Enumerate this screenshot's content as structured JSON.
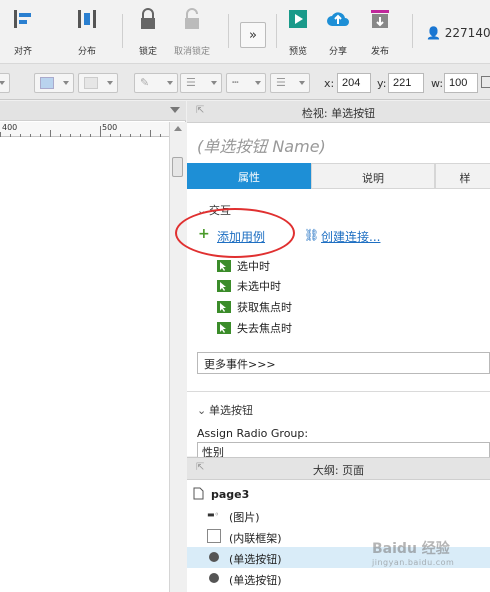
{
  "toolbar": {
    "align_label": "对齐",
    "distribute_label": "分布",
    "lock_label": "锁定",
    "unlock_label": "取消锁定",
    "preview_label": "预览",
    "share_label": "分享",
    "publish_label": "发布",
    "user_id": "227140",
    "preview_color": "#1a9a8a",
    "share_color": "#1e8fd6",
    "publish_color": "#c0279b"
  },
  "format_bar": {
    "x_label": "x:",
    "x_value": "204",
    "y_label": "y:",
    "y_value": "221",
    "w_label": "w:",
    "w_value": "100"
  },
  "canvas": {
    "ruler_labels": [
      "400",
      "500"
    ]
  },
  "inspector": {
    "title": "检视: 单选按钮",
    "widget_name_placeholder": "(单选按钮 Name)",
    "tabs": [
      "属性",
      "说明",
      "样"
    ],
    "active_tab_color": "#1e8fd6",
    "interactions_heading": "交互",
    "add_case_link": "添加用例",
    "create_link_link": "创建连接...",
    "events": [
      "选中时",
      "未选中时",
      "获取焦点时",
      "失去焦点时"
    ],
    "more_events": "更多事件>>>",
    "radio_section_heading": "单选按钮",
    "assign_group_label": "Assign Radio Group:",
    "assign_group_value": "性别",
    "annotation_color": "#e03030"
  },
  "outline": {
    "title": "大纲: 页面",
    "page_name": "page3",
    "items": [
      {
        "label": "(图片)",
        "icon": "image-icon",
        "selected": false
      },
      {
        "label": "(内联框架)",
        "icon": "iframe-icon",
        "selected": false
      },
      {
        "label": "(单选按钮)",
        "icon": "radio-icon",
        "selected": true
      },
      {
        "label": "(单选按钮)",
        "icon": "radio-icon",
        "selected": false
      }
    ],
    "selected_color": "#d9ecf8"
  },
  "watermark": {
    "text": "Baidu 经验",
    "sub": "jingyan.baidu.com"
  }
}
